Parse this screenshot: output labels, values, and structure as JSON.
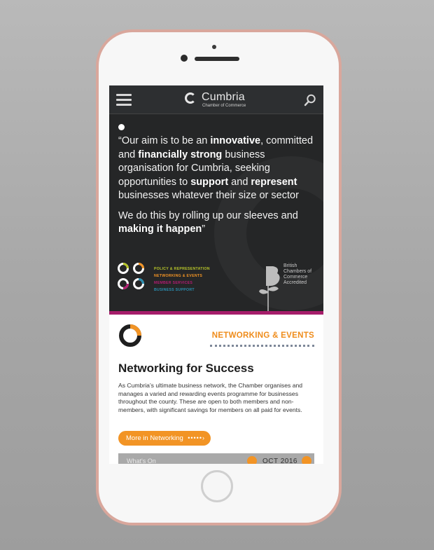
{
  "header": {
    "menu_icon": "hamburger-icon",
    "logo_name": "Cumbria",
    "logo_sub": "Chamber of Commerce",
    "search_icon": "search-icon"
  },
  "hero": {
    "quote_p1": [
      {
        "t": "“Our aim is to be an ",
        "b": false
      },
      {
        "t": "innovative",
        "b": true
      },
      {
        "t": ", committed and ",
        "b": false
      },
      {
        "t": "financially strong",
        "b": true
      },
      {
        "t": " business organisation for Cumbria, seeking opportunities to ",
        "b": false
      },
      {
        "t": "support",
        "b": true
      },
      {
        "t": " and ",
        "b": false
      },
      {
        "t": "represent",
        "b": true
      },
      {
        "t": " businesses whatever their size or sector",
        "b": false
      }
    ],
    "quote_p2": [
      {
        "t": "We do this by rolling up our sleeves and ",
        "b": false
      },
      {
        "t": "making it happen",
        "b": true
      },
      {
        "t": "”",
        "b": false
      }
    ],
    "services": [
      {
        "label": "POLICY & REPRESENTATION",
        "color": "#b7c52a"
      },
      {
        "label": "NETWORKING & EVENTS",
        "color": "#f29425"
      },
      {
        "label": "MEMBER SERVICES",
        "color": "#b31d72"
      },
      {
        "label": "BUSINESS SUPPORT",
        "color": "#2a8fb1"
      }
    ],
    "accreditation": [
      "British",
      "Chambers of",
      "Commerce",
      "Accredited"
    ]
  },
  "colors": {
    "accent_orange": "#f29425",
    "accent_magenta": "#a51d6a",
    "dark_bg": "#252627"
  },
  "card": {
    "section_label": "NETWORKING & EVENTS",
    "title": "Networking for Success",
    "body": "As Cumbria’s ultimate business network, the Chamber organises and manages a varied and rewarding events programme for businesses throughout the county. These are open to both members and non-members, with significant savings for members on all paid for events.",
    "button_label": "More in Networking",
    "event_partial_label": "What's On",
    "event_date": "OCT 2016"
  }
}
